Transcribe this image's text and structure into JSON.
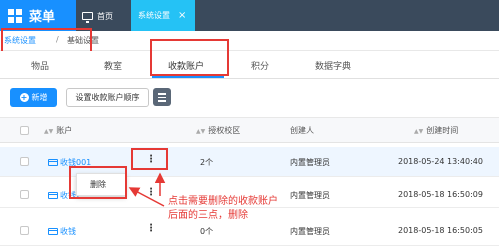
{
  "header": {
    "menu_title": "菜单",
    "tabs": [
      {
        "label": "首页"
      },
      {
        "label": "系统设置",
        "close": "×"
      }
    ]
  },
  "breadcrumb": {
    "items": [
      "系统设置",
      "基础设置"
    ],
    "separator": "/"
  },
  "subtabs": [
    "物品",
    "教室",
    "收款账户",
    "积分",
    "数据字典"
  ],
  "toolbar": {
    "new_label": "新增",
    "order_label": "设置收款账户顺序"
  },
  "table": {
    "columns": [
      "账户",
      "授权校区",
      "创建人",
      "创建时间"
    ],
    "rows": [
      {
        "account": "收钱001",
        "campus": "2个",
        "creator": "内置管理员",
        "created": "2018-05-24 13:40:40"
      },
      {
        "account": "收钱2",
        "campus": "",
        "creator": "内置管理员",
        "created": "2018-05-18 16:50:09"
      },
      {
        "account": "收钱",
        "campus": "0个",
        "creator": "内置管理员",
        "created": "2018-05-18 16:50:05"
      }
    ]
  },
  "row_menu": {
    "delete_label": "删除"
  },
  "annotation": {
    "line1": "点击需要删除的收款账户",
    "line2": "后面的三点，删除",
    "color": "#e53935"
  },
  "colors": {
    "accent": "#1890ff",
    "header": "#3a4a5c",
    "active_tab": "#25c2f5"
  }
}
